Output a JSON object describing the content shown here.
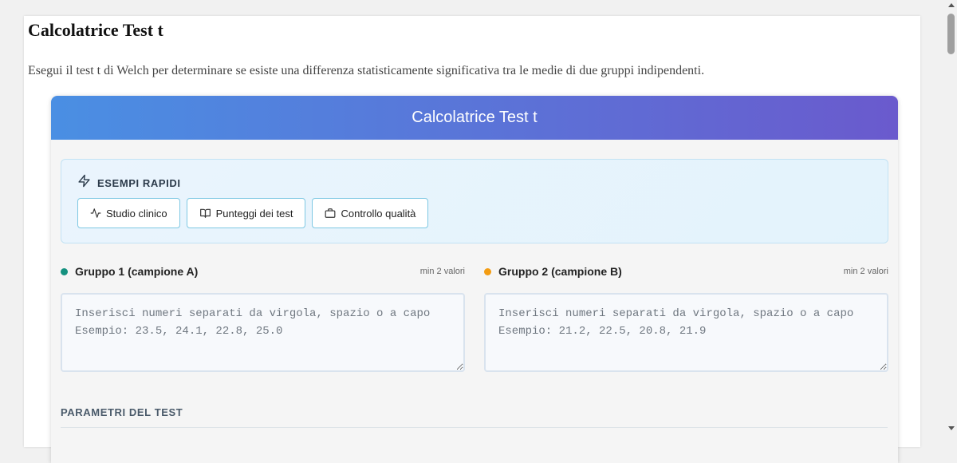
{
  "page": {
    "title": "Calcolatrice Test t",
    "description": "Esegui il test t di Welch per determinare se esiste una differenza statisticamente significativa tra le medie di due gruppi indipendenti."
  },
  "calculator": {
    "header": "Calcolatrice Test t",
    "examples": {
      "label": "ESEMPI RAPIDI",
      "icon": "lightning-icon",
      "buttons": [
        {
          "label": "Studio clinico",
          "icon": "activity-icon"
        },
        {
          "label": "Punteggi dei test",
          "icon": "book-icon"
        },
        {
          "label": "Controllo qualità",
          "icon": "briefcase-icon"
        }
      ]
    },
    "groups": [
      {
        "title": "Gruppo 1 (campione A)",
        "min_note": "min 2 valori",
        "dot_color": "#14917f",
        "value": "",
        "placeholder": "Inserisci numeri separati da virgola, spazio o a capo\nEsempio: 23.5, 24.1, 22.8, 25.0"
      },
      {
        "title": "Gruppo 2 (campione B)",
        "min_note": "min 2 valori",
        "dot_color": "#f39c12",
        "value": "",
        "placeholder": "Inserisci numeri separati da virgola, spazio o a capo\nEsempio: 21.2, 22.5, 20.8, 21.9"
      }
    ],
    "parameters_title": "PARAMETRI DEL TEST"
  },
  "colors": {
    "header_gradient_start": "#4a8fe3",
    "header_gradient_end": "#6a5acd",
    "button_border": "#7ec8e3"
  }
}
